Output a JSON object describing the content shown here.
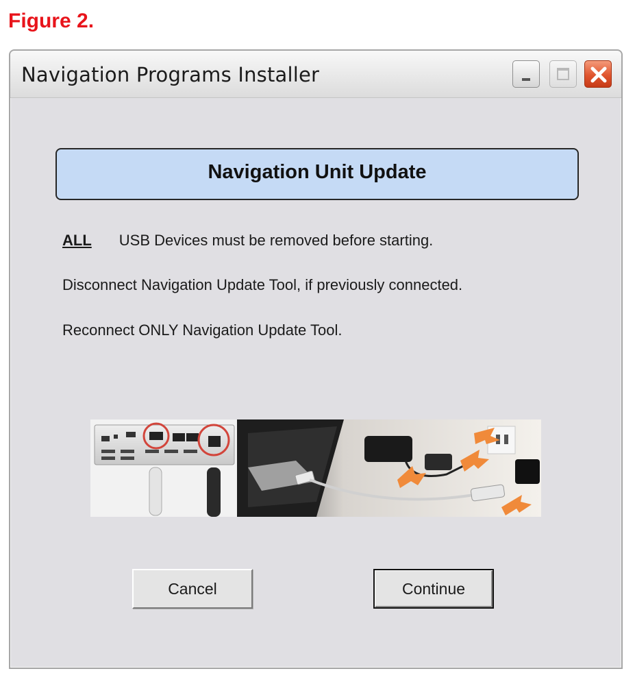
{
  "figure_label": "Figure 2.",
  "window": {
    "title": "Navigation Programs Installer",
    "controls": {
      "minimize": "minimize-icon",
      "maximize": "maximize-icon",
      "close": "close-icon"
    }
  },
  "banner": {
    "title": "Navigation Unit Update"
  },
  "instructions": {
    "line1_emphasis": "ALL",
    "line1_text": "USB Devices must be removed before starting.",
    "line2": "Disconnect Navigation Update Tool, if previously connected.",
    "line3": "Reconnect ONLY Navigation Update Tool."
  },
  "buttons": {
    "cancel": "Cancel",
    "continue": "Continue"
  },
  "colors": {
    "figure_label": "#e8141b",
    "banner_bg": "#c5daf5",
    "window_bg": "#e0dfe3",
    "close_button": "#e0552e"
  }
}
